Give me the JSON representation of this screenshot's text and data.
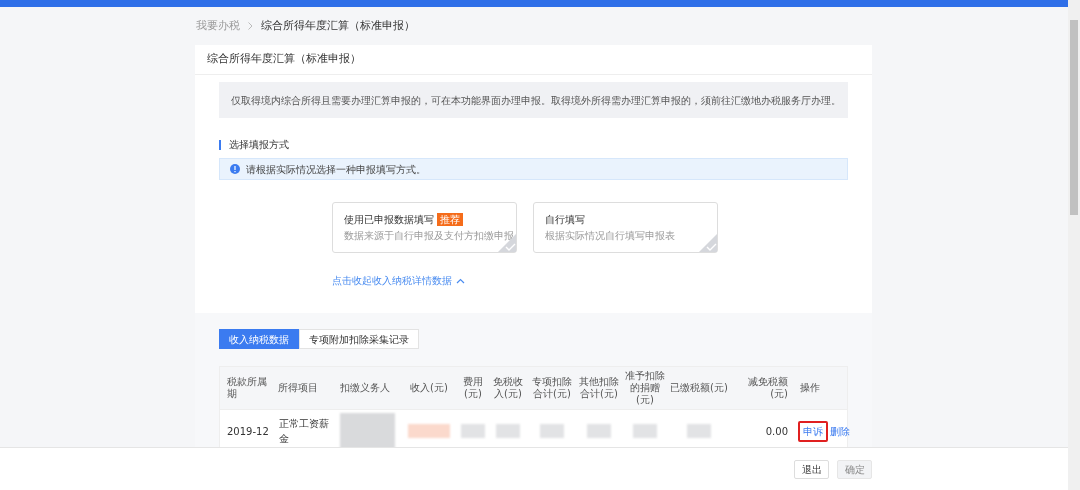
{
  "breadcrumb": {
    "parent": "我要办税",
    "current": "综合所得年度汇算（标准申报）"
  },
  "card_title": "综合所得年度汇算（标准申报）",
  "notice": "仅取得境内综合所得且需要办理汇算申报的，可在本功能界面办理申报。取得境外所得需办理汇算申报的，须前往汇缴地办税服务厅办理。",
  "section_title": "选择填报方式",
  "info_tip": "请根据实际情况选择一种申报填写方式。",
  "methods": [
    {
      "title": "使用已申报数据填写",
      "badge": "推荐",
      "desc": "数据来源于自行申报及支付方扣缴申报",
      "selected": false
    },
    {
      "title": "自行填写",
      "desc": "根据实际情况自行填写申报表",
      "selected": false
    }
  ],
  "collapse_link": "点击收起收入纳税详情数据",
  "tabs": [
    {
      "label": "收入纳税数据",
      "selected": true
    },
    {
      "label": "专项附加扣除采集记录",
      "selected": false
    }
  ],
  "table": {
    "columns": [
      "税款所属期",
      "所得项目",
      "扣缴义务人",
      "收入(元)",
      "费用(元)",
      "免税收入(元)",
      "专项扣除合计(元)",
      "其他扣除合计(元)",
      "准予扣除的捐赠(元)",
      "已缴税额(元)",
      "减免税额(元)",
      "操作"
    ],
    "rows": [
      {
        "period": "2019-12",
        "item": "正常工资薪金",
        "reduction": "0.00",
        "actions": [
          {
            "label": "申诉",
            "highlighted": true
          },
          {
            "label": "删除",
            "highlighted": false
          }
        ]
      }
    ]
  },
  "footer_buttons": [
    {
      "label": "退出",
      "disabled": false
    },
    {
      "label": "确定",
      "disabled": true
    }
  ]
}
